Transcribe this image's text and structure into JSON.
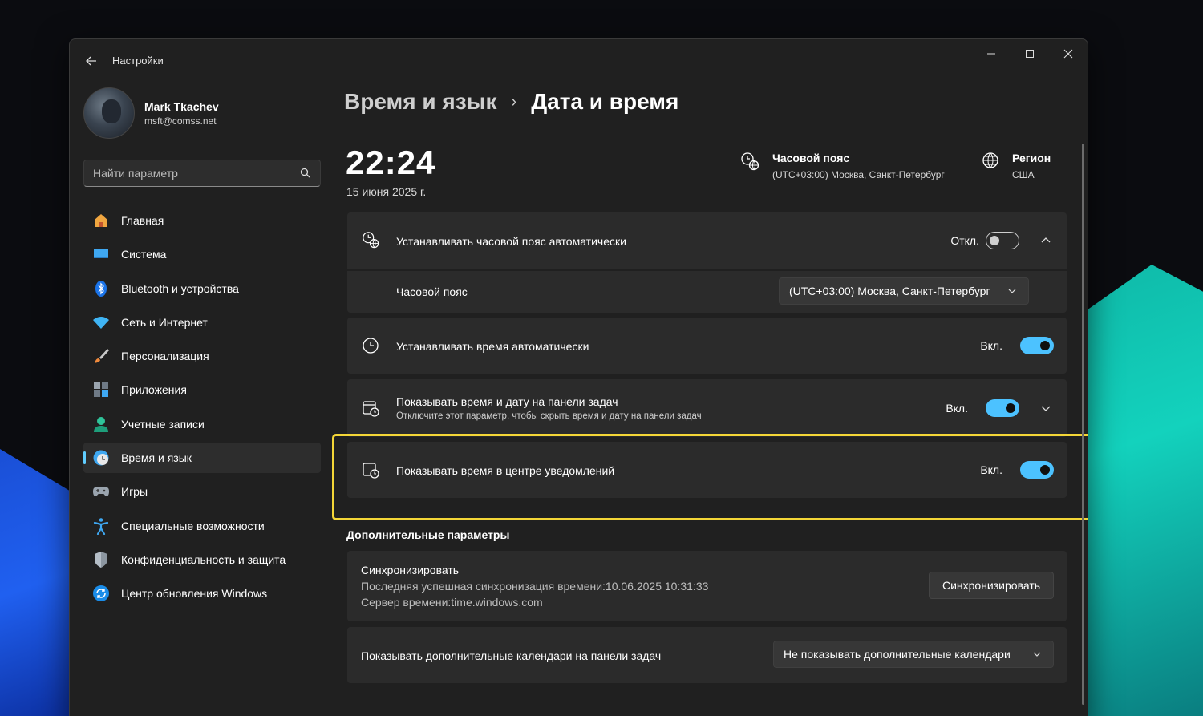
{
  "window": {
    "app_title": "Настройки"
  },
  "profile": {
    "name": "Mark Tkachev",
    "email": "msft@comss.net"
  },
  "search": {
    "placeholder": "Найти параметр"
  },
  "sidebar": {
    "items": [
      {
        "label": "Главная",
        "icon": "home-icon",
        "active": false
      },
      {
        "label": "Система",
        "icon": "system-icon",
        "active": false
      },
      {
        "label": "Bluetooth и устройства",
        "icon": "bluetooth-icon",
        "active": false
      },
      {
        "label": "Сеть и Интернет",
        "icon": "wifi-icon",
        "active": false
      },
      {
        "label": "Персонализация",
        "icon": "brush-icon",
        "active": false
      },
      {
        "label": "Приложения",
        "icon": "apps-icon",
        "active": false
      },
      {
        "label": "Учетные записи",
        "icon": "account-icon",
        "active": false
      },
      {
        "label": "Время и язык",
        "icon": "time-language-icon",
        "active": true
      },
      {
        "label": "Игры",
        "icon": "gamepad-icon",
        "active": false
      },
      {
        "label": "Специальные возможности",
        "icon": "accessibility-icon",
        "active": false
      },
      {
        "label": "Конфиденциальность и защита",
        "icon": "shield-icon",
        "active": false
      },
      {
        "label": "Центр обновления Windows",
        "icon": "update-icon",
        "active": false
      }
    ]
  },
  "breadcrumb": {
    "parent": "Время и язык",
    "separator": "›",
    "current": "Дата и время"
  },
  "clock": {
    "time": "22:24",
    "date": "15 июня 2025 г."
  },
  "timezone_info": {
    "title": "Часовой пояс",
    "value": "(UTC+03:00) Москва, Санкт-Петербург"
  },
  "region_info": {
    "title": "Регион",
    "value": "США"
  },
  "settings": {
    "auto_timezone": {
      "label": "Устанавливать часовой пояс автоматически",
      "state": "Откл.",
      "on": false
    },
    "timezone": {
      "label": "Часовой пояс",
      "value": "(UTC+03:00) Москва, Санкт-Петербург"
    },
    "auto_time": {
      "label": "Устанавливать время автоматически",
      "state": "Вкл.",
      "on": true
    },
    "taskbar_time": {
      "label": "Показывать время и дату на панели задач",
      "sub": "Отключите этот параметр, чтобы скрыть время и дату на панели задач",
      "state": "Вкл.",
      "on": true
    },
    "notification_time": {
      "label": "Показывать время в центре уведомлений",
      "state": "Вкл.",
      "on": true
    }
  },
  "additional": {
    "title": "Дополнительные параметры",
    "sync": {
      "title": "Синхронизировать",
      "last_sync": "Последняя успешная синхронизация времени:10.06.2025 10:31:33",
      "server": "Сервер времени:time.windows.com",
      "button": "Синхронизировать"
    },
    "calendars": {
      "label": "Показывать дополнительные календари на панели задач",
      "value": "Не показывать дополнительные календари"
    }
  },
  "colors": {
    "accent": "#4cc2ff",
    "highlight": "#f4d637",
    "window_bg": "#202020",
    "card_bg": "#2b2b2b"
  }
}
